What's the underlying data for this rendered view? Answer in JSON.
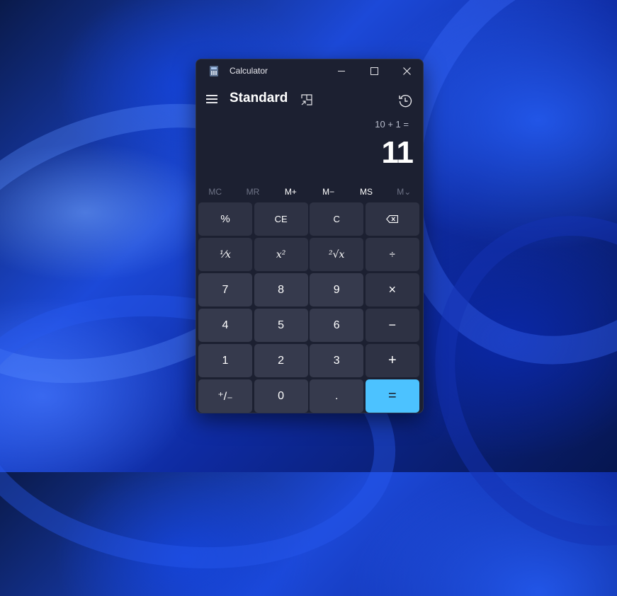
{
  "window": {
    "title": "Calculator",
    "controls": {
      "minimize": "minimize",
      "maximize": "maximize",
      "close": "close"
    }
  },
  "header": {
    "mode": "Standard",
    "icons": {
      "menu": "hamburger-icon",
      "keep_on_top": "keep-on-top-icon",
      "history": "history-icon"
    }
  },
  "display": {
    "expression": "10 + 1 =",
    "result": "11"
  },
  "memory": [
    {
      "label": "MC",
      "enabled": false
    },
    {
      "label": "MR",
      "enabled": false
    },
    {
      "label": "M+",
      "enabled": true
    },
    {
      "label": "M−",
      "enabled": true
    },
    {
      "label": "MS",
      "enabled": true
    },
    {
      "label": "M⌄",
      "enabled": false
    }
  ],
  "keys": {
    "percent": "%",
    "clear_entry": "CE",
    "clear": "C",
    "backspace": "backspace-icon",
    "reciprocal": "⅟x",
    "square": "x²",
    "sqrt": "²√x",
    "divide": "÷",
    "seven": "7",
    "eight": "8",
    "nine": "9",
    "multiply": "×",
    "four": "4",
    "five": "5",
    "six": "6",
    "subtract": "−",
    "one": "1",
    "two": "2",
    "three": "3",
    "add": "+",
    "negate": "⁺/₋",
    "zero": "0",
    "decimal": ".",
    "equals": "="
  },
  "colors": {
    "accent": "#4cc2ff",
    "window_bg": "#1c2031",
    "key_bg": "#2e3244",
    "number_key_bg": "#363a4d"
  }
}
